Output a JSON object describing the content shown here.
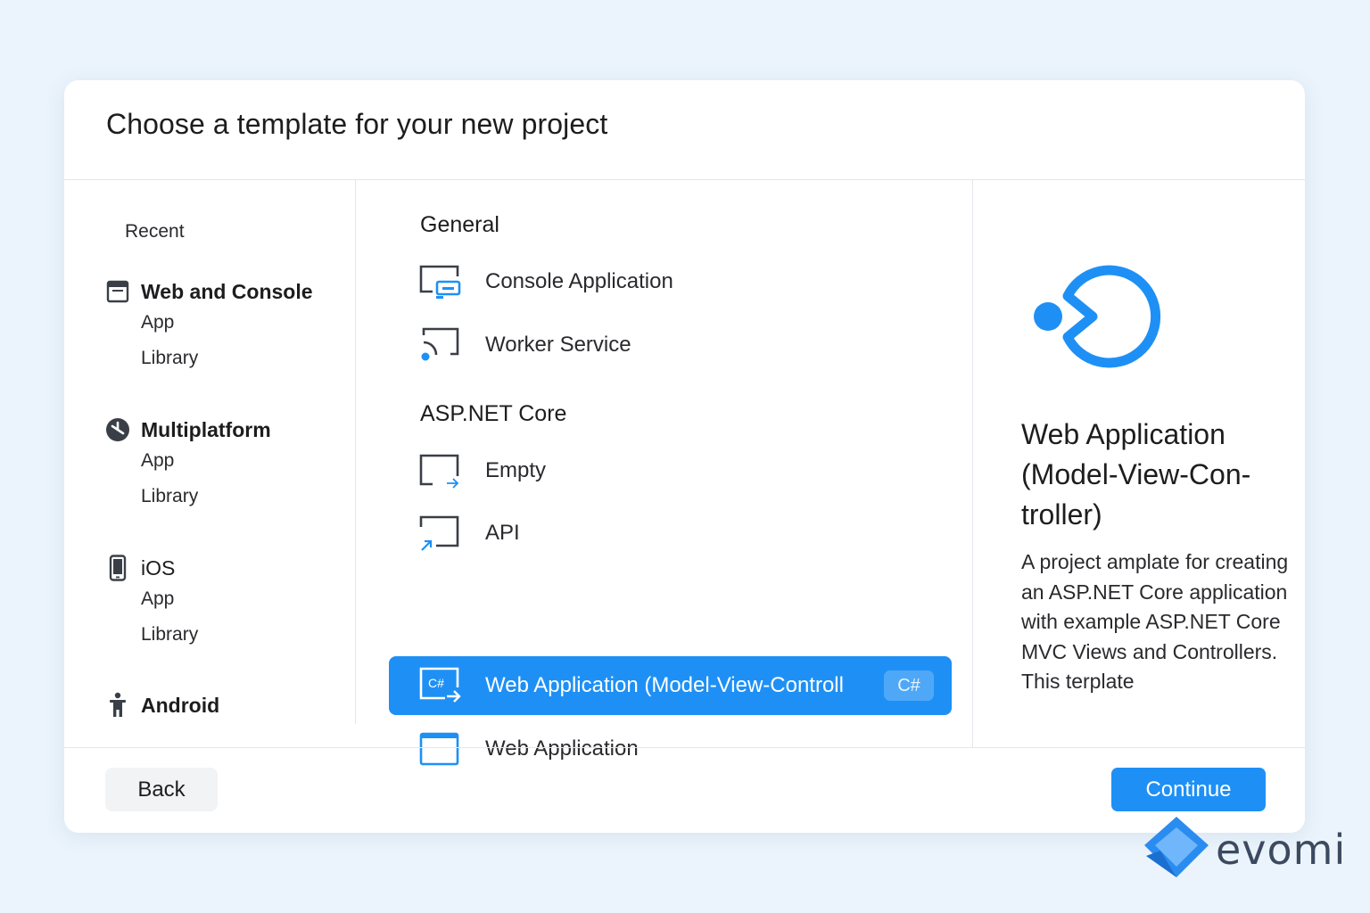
{
  "dialog": {
    "title": "Choose a template for your new project"
  },
  "sidebar": {
    "recent": "Recent",
    "groups": [
      {
        "label": "Web and Console",
        "icon": "window-icon",
        "items": [
          "App",
          "Library"
        ]
      },
      {
        "label": "Multiplatform",
        "icon": "multiplatform-icon",
        "items": [
          "App",
          "Library"
        ]
      },
      {
        "label": "iOS",
        "icon": "phone-icon",
        "items": [
          "App",
          "Library"
        ]
      },
      {
        "label": "Android",
        "icon": "android-icon",
        "items": []
      }
    ]
  },
  "templates": {
    "sections": [
      {
        "title": "General",
        "items": [
          "Console Application",
          "Worker Service"
        ]
      },
      {
        "title": "ASP.NET Core",
        "items": [
          "Empty",
          "API",
          "Web Application (Model-View-Controll",
          "Web Application"
        ]
      }
    ],
    "selected": "Web Application (Model-View-Controll",
    "selected_badge": "C#"
  },
  "detail": {
    "title": "Web Application (Model-View-Con-troller)",
    "description": "A project amplate for creating an ASP.NET Core application with example ASP.NET Core MVC Views and Controllers. This terplate"
  },
  "footer": {
    "back_label": "Back",
    "continue_label": "Continue"
  },
  "brand": {
    "name": "evomi"
  },
  "colors": {
    "accent": "#1e90f5",
    "background": "#ebf4fc"
  }
}
